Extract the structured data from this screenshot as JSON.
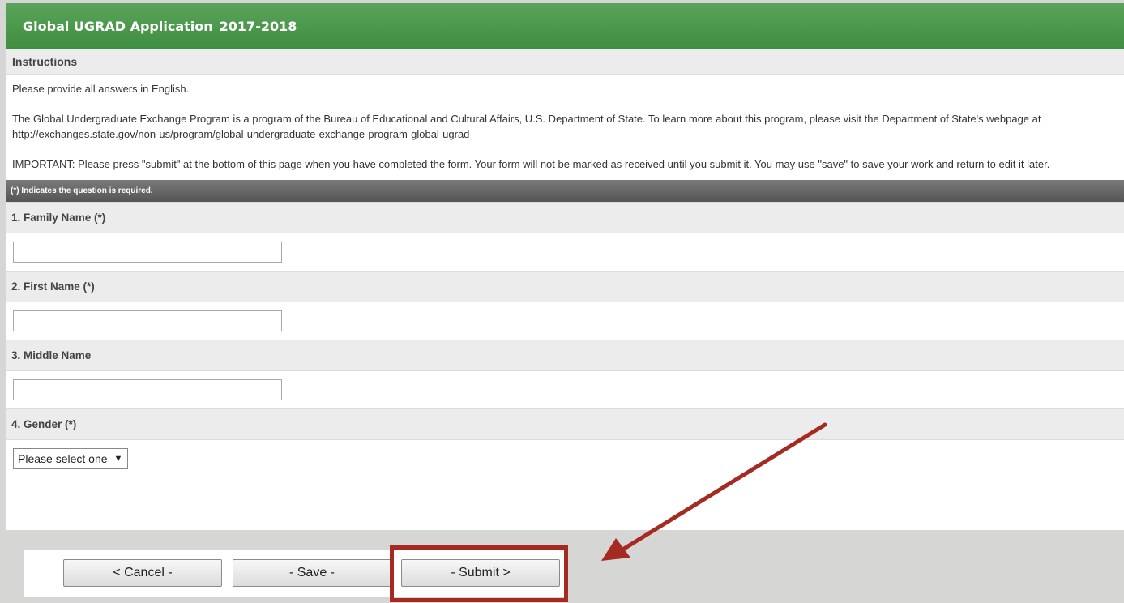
{
  "header": {
    "title": "Global UGRAD Application",
    "year": "2017-2018"
  },
  "instructions": {
    "heading": "Instructions",
    "paragraphs": [
      "Please provide all answers in English.",
      "The Global Undergraduate Exchange Program is a program of the Bureau of Educational and Cultural Affairs, U.S. Department of State. To learn more about this program, please visit the Department of State's webpage at http://exchanges.state.gov/non-us/program/global-undergraduate-exchange-program-global-ugrad",
      "IMPORTANT: Please press \"submit\" at the bottom of this page when you have completed the form. Your form will not be marked as received until you submit it. You may use \"save\" to save your work and return to edit it later."
    ]
  },
  "required_note": "(*) Indicates the question is required.",
  "questions": [
    {
      "label": "1. Family Name  (*)",
      "value": ""
    },
    {
      "label": "2. First Name  (*)",
      "value": ""
    },
    {
      "label": "3. Middle Name",
      "value": ""
    },
    {
      "label": "4. Gender  (*)",
      "selected": "Please select one"
    }
  ],
  "buttons": {
    "cancel": "< Cancel -",
    "save": "- Save -",
    "submit": "- Submit >"
  },
  "icons": {
    "dropdown": "triangle-down-icon"
  },
  "colors": {
    "header_green": "#4a9a4c",
    "annotation_red": "#a52a22"
  }
}
